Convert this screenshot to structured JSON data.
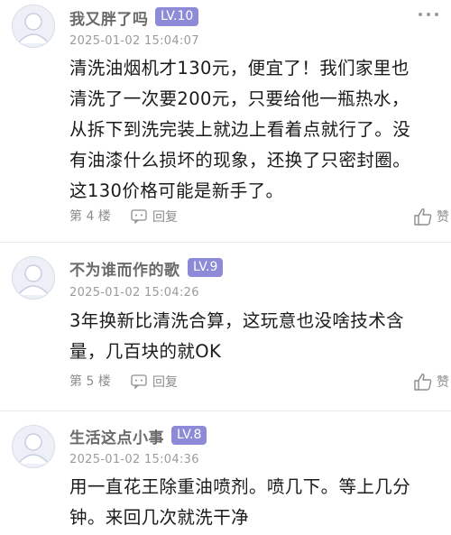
{
  "comments": [
    {
      "username": "我又胖了吗",
      "level": "LV.10",
      "timestamp": "2025-01-02 15:04:07",
      "content": [
        "清洗油烟机才130元，便宜了！我们家里也",
        "清洗了一次要200元，只要给他一瓶热水，",
        "从拆下到洗完装上就边上看着点就行了。没",
        "有油漆什么损坏的现象，还换了只密封圈。",
        "这130价格可能是新手了。"
      ],
      "floor": "第 4 楼",
      "reply_label": "回复",
      "like_label": "赞"
    },
    {
      "username": "不为谁而作的歌",
      "level": "LV.9",
      "timestamp": "2025-01-02 15:04:26",
      "content": [
        "3年换新比清洗合算，这玩意也没啥技术含",
        "量，几百块的就OK"
      ],
      "floor": "第 5 楼",
      "reply_label": "回复",
      "like_label": "赞"
    },
    {
      "username": "生活这点小事",
      "level": "LV.8",
      "timestamp": "2025-01-02 15:04:36",
      "content": [
        "用一直花王除重油喷剂。喷几下。等上几分",
        "钟。来回几次就洗干净"
      ]
    }
  ],
  "colors": {
    "level_badge": "#8d8bd8",
    "username": "#6a6a6a",
    "meta": "#9b9b9b",
    "divider": "#eaeaea"
  },
  "icons": {
    "more": "more-dots-icon",
    "reply": "reply-bubble-icon",
    "like": "thumbs-up-icon",
    "avatar": "default-avatar-icon"
  }
}
